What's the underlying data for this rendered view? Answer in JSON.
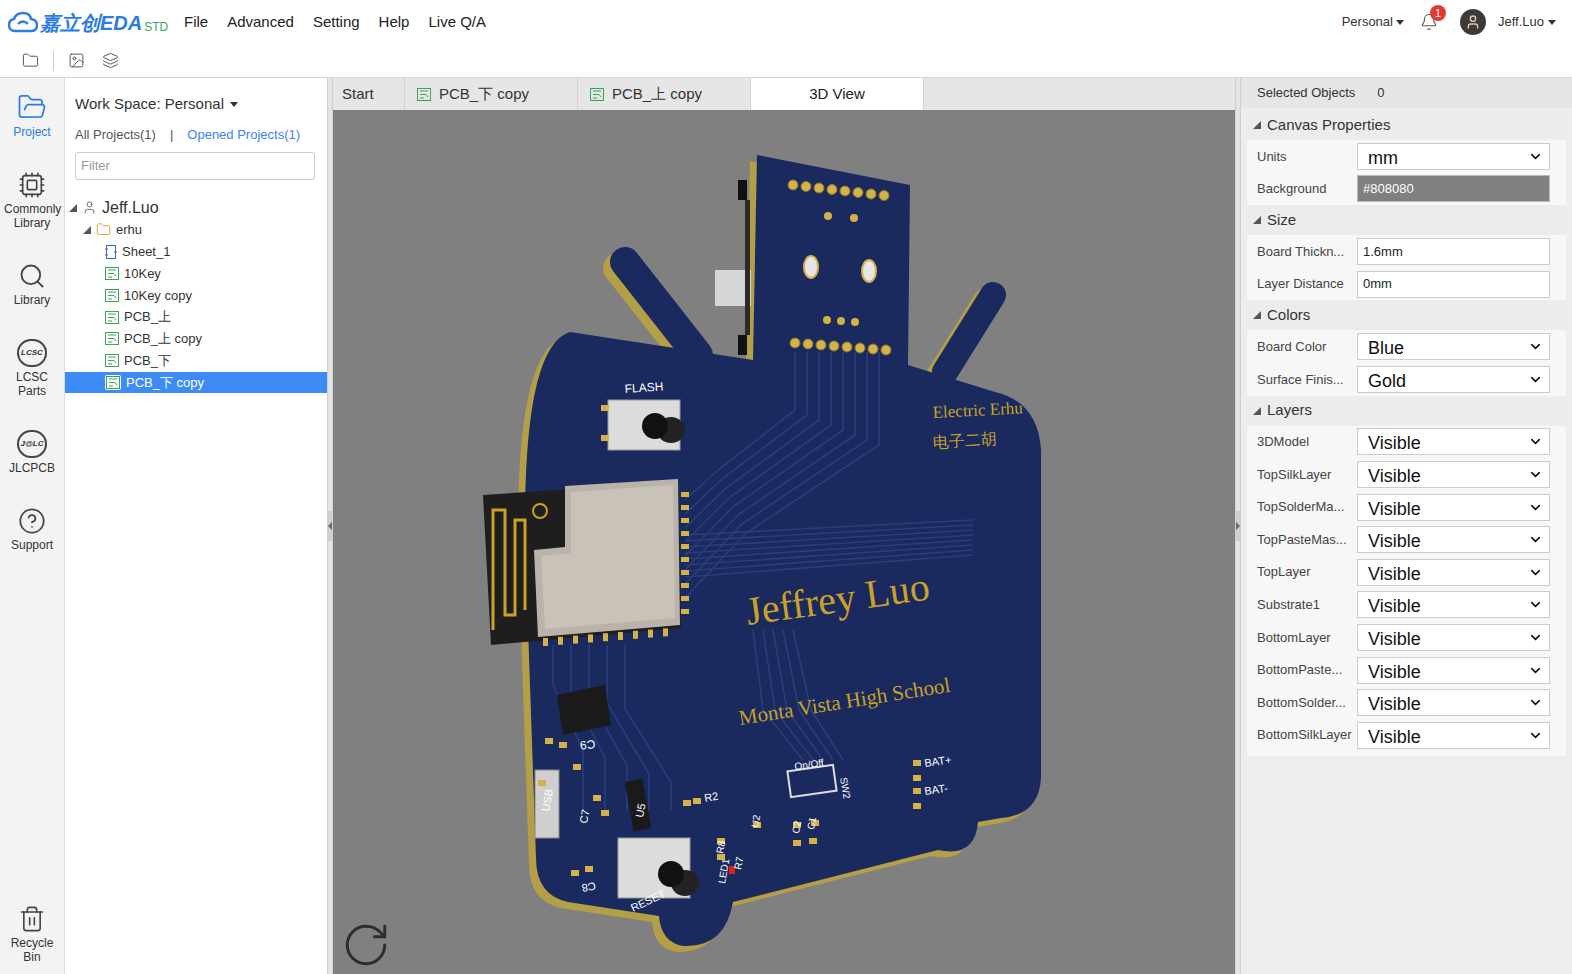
{
  "header": {
    "logo": "嘉立创EDA",
    "edition": "STD",
    "menu": [
      "File",
      "Advanced",
      "Setting",
      "Help",
      "Live Q/A"
    ],
    "workspace": "Personal",
    "notifications": "1",
    "user": "Jeff.Luo"
  },
  "sidebar": {
    "items": [
      {
        "label": "Project",
        "kind": "project",
        "selected": true
      },
      {
        "label": "Commonly Library",
        "kind": "common",
        "selected": false
      },
      {
        "label": "Library",
        "kind": "library",
        "selected": false
      },
      {
        "label": "LCSC Parts",
        "kind": "lcsc",
        "logo": "LCSC",
        "selected": false
      },
      {
        "label": "JLCPCB",
        "kind": "jlc",
        "logo": "J@LC",
        "selected": false
      },
      {
        "label": "Support",
        "kind": "support",
        "selected": false
      }
    ],
    "bottom": {
      "label": "Recycle Bin",
      "kind": "trash"
    }
  },
  "project_panel": {
    "workspace": "Work Space: Personal",
    "links": [
      {
        "label": "All Projects(1)",
        "selected": false
      },
      {
        "label": "Opened Projects(1)",
        "selected": true
      }
    ],
    "separator": "|",
    "filter_placeholder": "Filter",
    "tree": [
      {
        "label": "Jeff.Luo",
        "kind": "user",
        "depth": 0,
        "expanded": true,
        "selected": false
      },
      {
        "label": "erhu",
        "kind": "folder",
        "depth": 1,
        "expanded": true,
        "selected": false
      },
      {
        "label": "Sheet_1",
        "kind": "schematic",
        "depth": 2,
        "selected": false
      },
      {
        "label": "10Key",
        "kind": "pcb",
        "depth": 2,
        "selected": false
      },
      {
        "label": "10Key copy",
        "kind": "pcb",
        "depth": 2,
        "selected": false
      },
      {
        "label": "PCB_上",
        "kind": "pcb",
        "depth": 2,
        "selected": false
      },
      {
        "label": "PCB_上 copy",
        "kind": "pcb",
        "depth": 2,
        "selected": false
      },
      {
        "label": "PCB_下",
        "kind": "pcb",
        "depth": 2,
        "selected": false
      },
      {
        "label": "PCB_下 copy",
        "kind": "pcb",
        "depth": 2,
        "selected": true
      }
    ]
  },
  "tabs": [
    {
      "label": "Start",
      "kind": "start",
      "selected": false
    },
    {
      "label": "PCB_下 copy",
      "kind": "pcb",
      "selected": false
    },
    {
      "label": "PCB_上 copy",
      "kind": "pcb",
      "selected": false
    },
    {
      "label": "3D View",
      "kind": "view",
      "selected": true
    }
  ],
  "viewport": {
    "board": {
      "title_en": "Electric Erhu",
      "title_zh": "电子二胡",
      "name": "Jeffrey Luo",
      "school": "Monta Vista High School"
    },
    "silkscreen": [
      "FLASH",
      "RESET",
      "USB",
      "C9",
      "C7",
      "U5",
      "R2",
      "C8",
      "LED1",
      "R8",
      "R7",
      "U2",
      "C2",
      "C1",
      "On/Off",
      "SW2",
      "BAT+",
      "BAT-"
    ]
  },
  "properties": {
    "selected_label": "Selected Objects",
    "selected_count": "0",
    "sections": [
      {
        "title": "Canvas Properties",
        "expanded": true,
        "rows": [
          {
            "label": "Units",
            "value": "mm",
            "kind": "select"
          },
          {
            "label": "Background",
            "value": "#808080",
            "kind": "color"
          }
        ]
      },
      {
        "title": "Size",
        "expanded": true,
        "rows": [
          {
            "label": "Board Thickn...",
            "value": "1.6mm",
            "kind": "input"
          },
          {
            "label": "Layer Distance",
            "value": "0mm",
            "kind": "input"
          }
        ]
      },
      {
        "title": "Colors",
        "expanded": true,
        "rows": [
          {
            "label": "Board Color",
            "value": "Blue",
            "kind": "select"
          },
          {
            "label": "Surface Finis...",
            "value": "Gold",
            "kind": "select"
          }
        ]
      },
      {
        "title": "Layers",
        "expanded": true,
        "rows": [
          {
            "label": "3DModel",
            "value": "Visible",
            "kind": "select"
          },
          {
            "label": "TopSilkLayer",
            "value": "Visible",
            "kind": "select"
          },
          {
            "label": "TopSolderMa...",
            "value": "Visible",
            "kind": "select"
          },
          {
            "label": "TopPasteMas...",
            "value": "Visible",
            "kind": "select"
          },
          {
            "label": "TopLayer",
            "value": "Visible",
            "kind": "select"
          },
          {
            "label": "Substrate1",
            "value": "Visible",
            "kind": "select"
          },
          {
            "label": "BottomLayer",
            "value": "Visible",
            "kind": "select"
          },
          {
            "label": "BottomPaste...",
            "value": "Visible",
            "kind": "select"
          },
          {
            "label": "BottomSolder...",
            "value": "Visible",
            "kind": "select"
          },
          {
            "label": "BottomSilkLayer",
            "value": "Visible",
            "kind": "select"
          }
        ]
      }
    ]
  }
}
